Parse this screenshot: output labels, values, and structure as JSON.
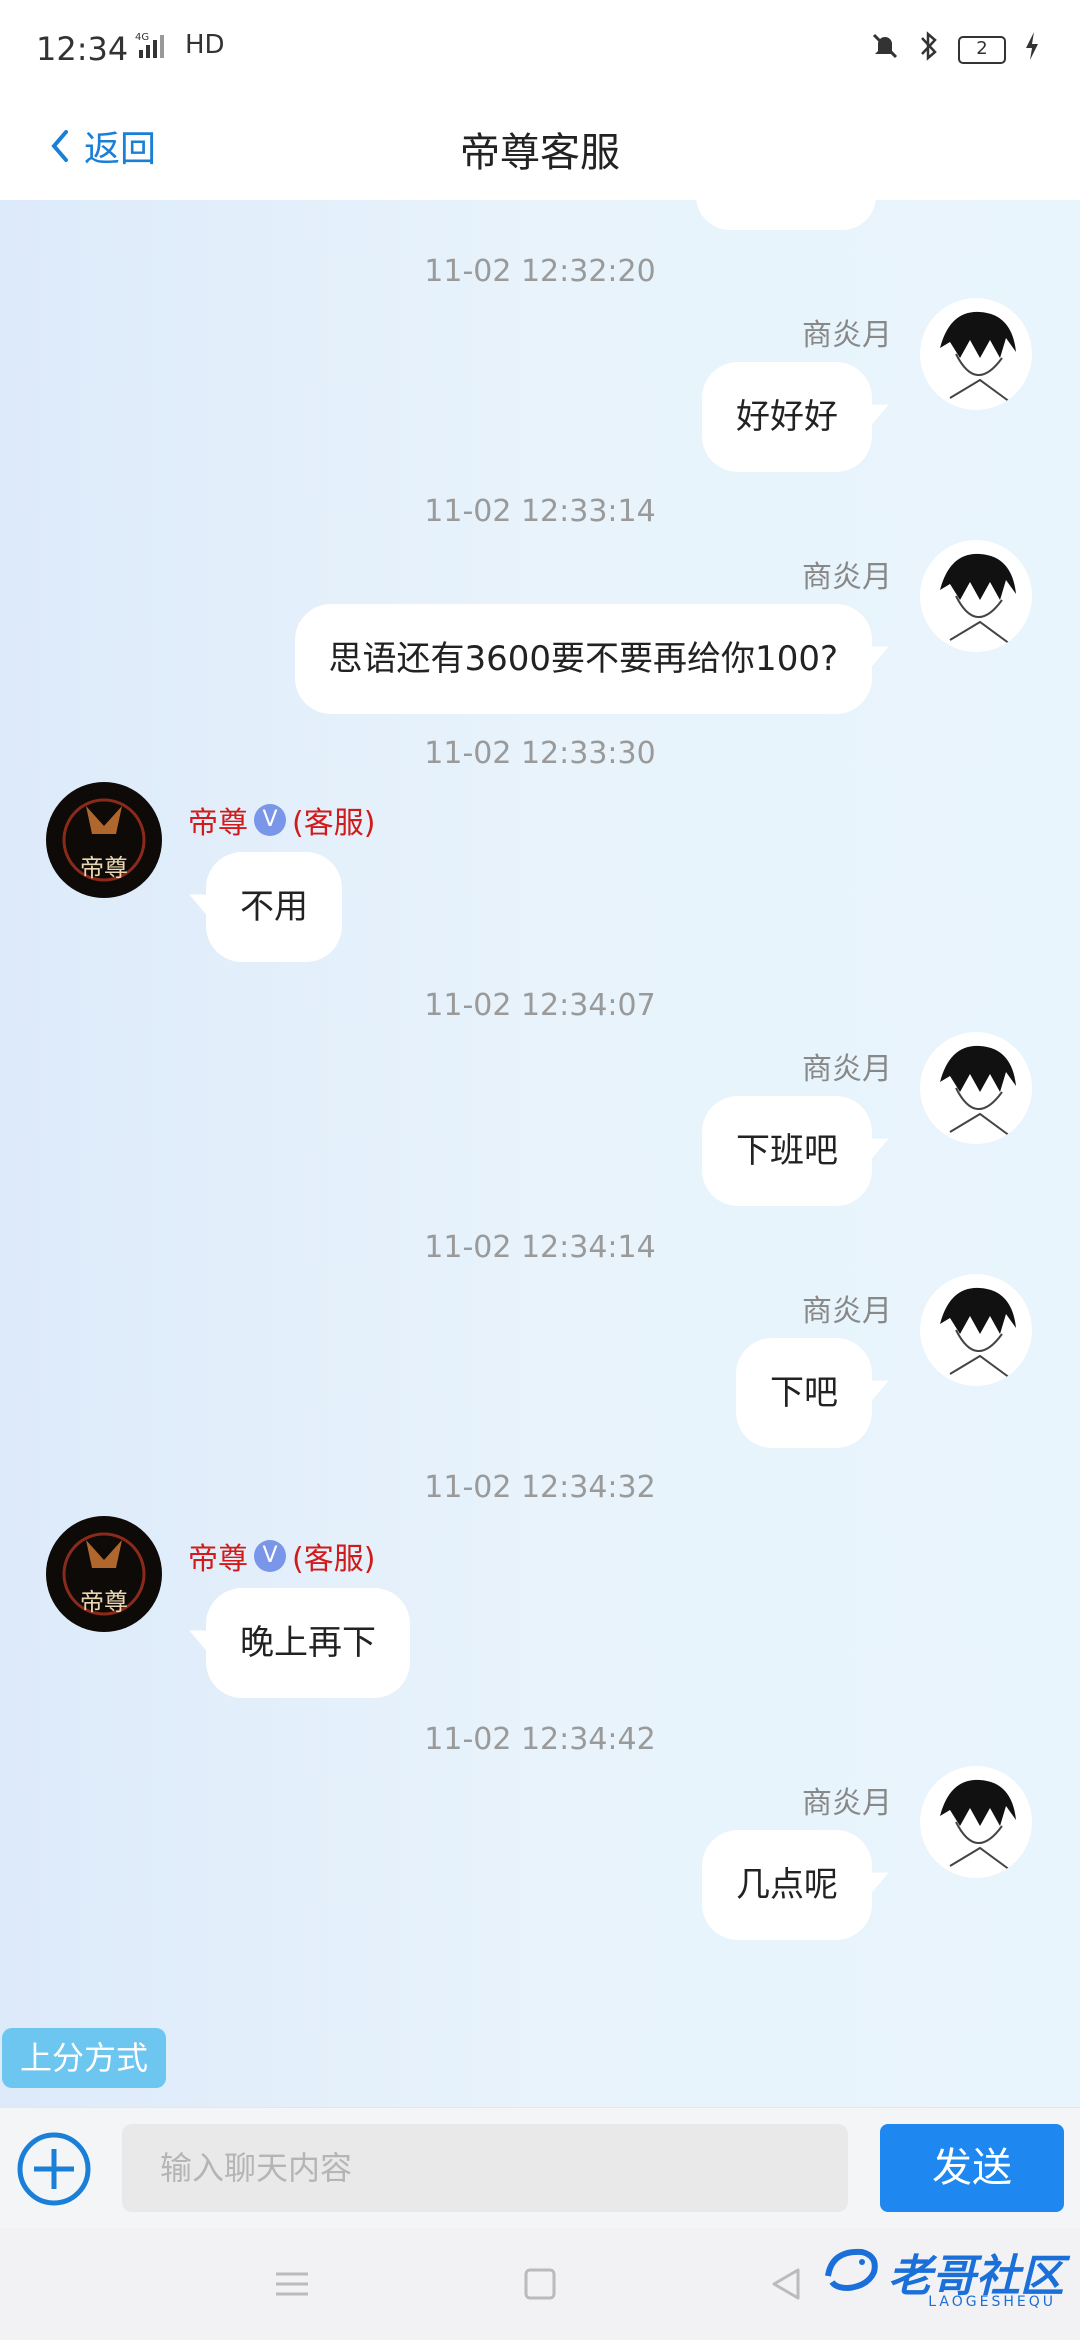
{
  "status_bar": {
    "time": "12:34",
    "network": "4G",
    "hd": "HD",
    "battery": "2"
  },
  "header": {
    "back_label": "返回",
    "title": "帝尊客服"
  },
  "my_name": "商炎月",
  "service": {
    "name": "帝尊",
    "badge": "V",
    "role": "(客服)",
    "avatar_text": "帝尊"
  },
  "messages": [
    {
      "time": "11-02 12:32:20",
      "sender": "me",
      "text": "好好好"
    },
    {
      "time": "11-02 12:33:14",
      "sender": "me",
      "text": "思语还有3600要不要再给你100?"
    },
    {
      "time": "11-02 12:33:30",
      "sender": "service",
      "text": "不用"
    },
    {
      "time": "11-02 12:34:07",
      "sender": "me",
      "text": "下班吧"
    },
    {
      "time": "11-02 12:34:14",
      "sender": "me",
      "text": "下吧"
    },
    {
      "time": "11-02 12:34:32",
      "sender": "service",
      "text": "晚上再下"
    },
    {
      "time": "11-02 12:34:42",
      "sender": "me",
      "text": "几点呢"
    }
  ],
  "quick_button": "上分方式",
  "input": {
    "placeholder": "输入聊天内容",
    "value": ""
  },
  "send_label": "发送",
  "watermark": {
    "title": "老哥社区",
    "subtitle": "LAOGESHEQU"
  },
  "colors": {
    "accent": "#1E88F0",
    "service_name": "#D11A1A",
    "quick_button": "#6CC6F0"
  }
}
